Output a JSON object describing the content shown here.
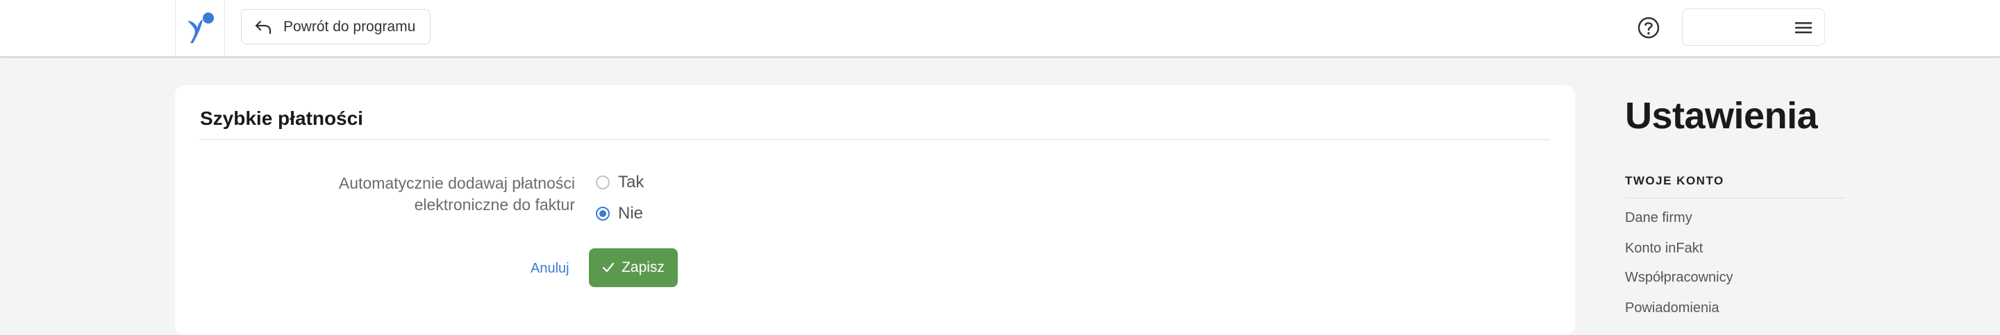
{
  "header": {
    "back_label": "Powrót do programu",
    "brand_color": "#3a7bd5"
  },
  "card": {
    "title": "Szybkie płatności",
    "field_label_line1": "Automatycznie dodawaj płatności",
    "field_label_line2": "elektroniczne do faktur",
    "options": [
      {
        "label": "Tak",
        "selected": false
      },
      {
        "label": "Nie",
        "selected": true
      }
    ],
    "cancel_label": "Anuluj",
    "save_label": "Zapisz",
    "save_color": "#5b9a4e"
  },
  "sidebar": {
    "title": "Ustawienia",
    "section_label": "TWOJE KONTO",
    "items": [
      {
        "label": "Dane firmy"
      },
      {
        "label": "Konto inFakt"
      },
      {
        "label": "Współpracownicy"
      },
      {
        "label": "Powiadomienia"
      }
    ]
  }
}
